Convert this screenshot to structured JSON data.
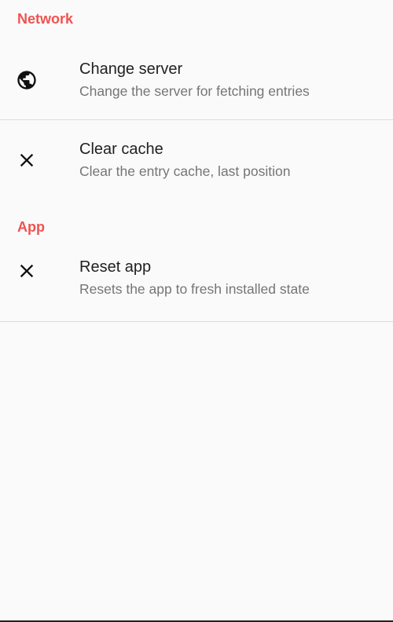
{
  "sections": [
    {
      "header": "Network",
      "items": [
        {
          "title": "Change server",
          "summary": "Change the server for fetching entries",
          "icon": "globe-icon"
        },
        {
          "title": "Clear cache",
          "summary": "Clear the entry cache, last position",
          "icon": "close-icon"
        }
      ]
    },
    {
      "header": "App",
      "items": [
        {
          "title": "Reset app",
          "summary": "Resets the app to fresh installed state",
          "icon": "close-icon"
        }
      ]
    }
  ],
  "colors": {
    "accent": "#ef5350",
    "background": "#fafafa",
    "title_text": "#212121",
    "summary_text": "#757575",
    "divider": "#dcdcdc"
  }
}
